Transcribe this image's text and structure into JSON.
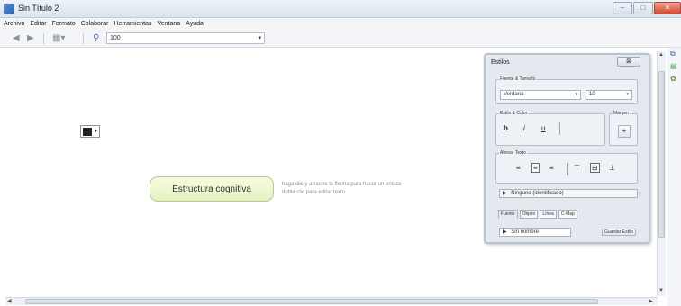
{
  "window": {
    "title": "Sin Título 2"
  },
  "menu": [
    "Archivo",
    "Editar",
    "Formato",
    "Colaborar",
    "Herramientas",
    "Ventana",
    "Ayuda"
  ],
  "toolbar": {
    "zoom_value": "100"
  },
  "canvas": {
    "concept_label": "Estructura cognitiva",
    "hint_line1": "haga clic y arrastre la flecha para hacer un enlace",
    "hint_line2": "doble clic para editar texto"
  },
  "styles_panel": {
    "title": "Estilos",
    "font_group_label": "Fuente & Tamaño",
    "font_family": "Verdana",
    "font_size": "10",
    "style_color_label": "Estilo & Color",
    "bold": "b",
    "italic": "i",
    "underline": "u",
    "margin_label": "Margen",
    "margin_value": "+",
    "text_group_label": "Alinear Texto",
    "selected_label": "Ninguno (identificado)",
    "tabs": [
      "Fuente",
      "Objeto",
      "Línea",
      "C-Map"
    ],
    "style_name": "Sin nombre",
    "save_style_button": "Guardar Estilo"
  },
  "colors": {
    "concept_fill": "#e6f2c1",
    "concept_border": "#b7c99a",
    "panel_bg": "#e4e9ef"
  }
}
